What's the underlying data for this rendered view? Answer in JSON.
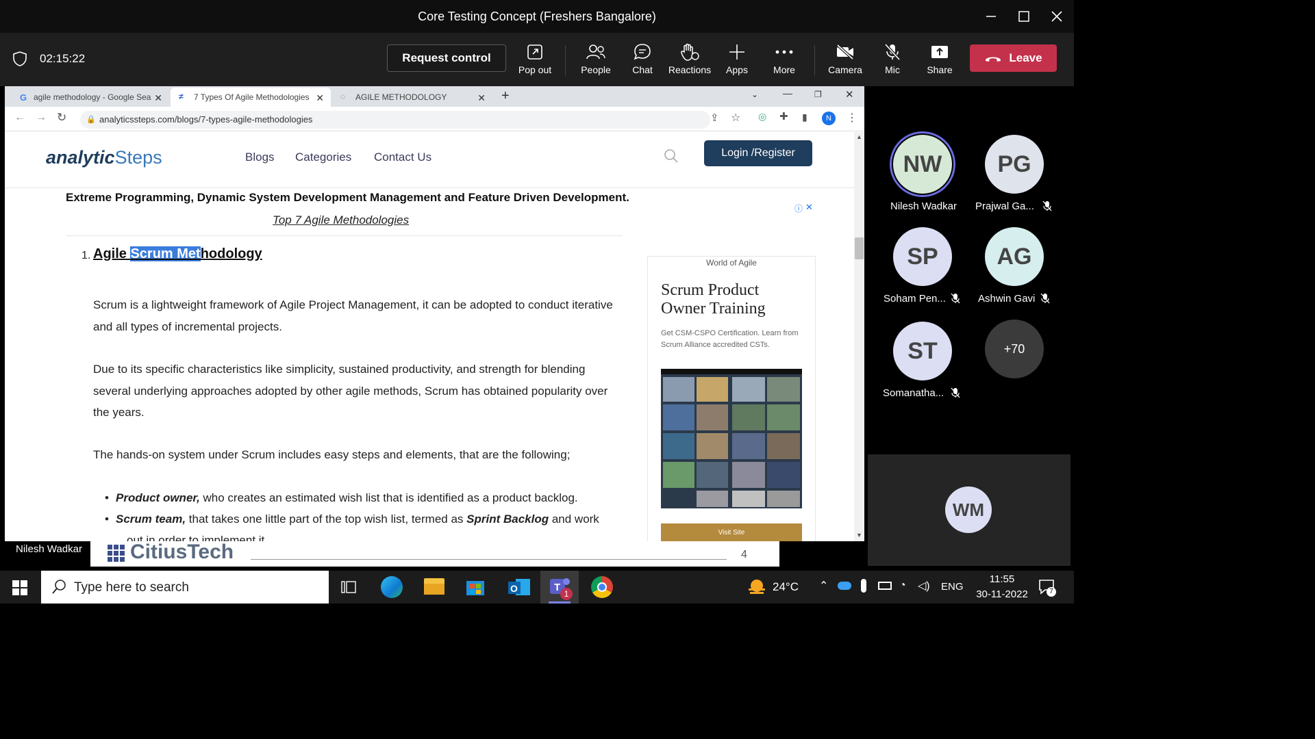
{
  "meeting": {
    "title": "Core Testing Concept (Freshers Bangalore)",
    "timer": "02:15:22",
    "request_control": "Request control",
    "toolbar": [
      {
        "label": "Pop out",
        "icon": "pop-out-icon"
      },
      {
        "label": "People",
        "icon": "people-icon"
      },
      {
        "label": "Chat",
        "icon": "chat-icon"
      },
      {
        "label": "Reactions",
        "icon": "reactions-icon"
      },
      {
        "label": "Apps",
        "icon": "apps-plus-icon"
      },
      {
        "label": "More",
        "icon": "more-dots-icon"
      },
      {
        "label": "Camera",
        "icon": "camera-off-icon"
      },
      {
        "label": "Mic",
        "icon": "mic-off-icon"
      },
      {
        "label": "Share",
        "icon": "share-icon"
      }
    ],
    "leave": "Leave",
    "presenter": "Nilesh Wadkar",
    "presenter_overlay": {
      "logo": "CitiusTech",
      "page": "4"
    }
  },
  "participants": [
    {
      "initials": "NW",
      "name": "Nilesh Wadkar",
      "muted": false,
      "color": "#d6e9d6",
      "speaking": true
    },
    {
      "initials": "PG",
      "name": "Prajwal Ga...",
      "muted": true,
      "color": "#dfe3ec"
    },
    {
      "initials": "SP",
      "name": "Soham Pen...",
      "muted": true,
      "color": "#dcdff3"
    },
    {
      "initials": "AG",
      "name": "Ashwin Gavi",
      "muted": true,
      "color": "#d7eeee"
    },
    {
      "initials": "ST",
      "name": "Somanatha...",
      "muted": true,
      "color": "#dcdff3"
    },
    {
      "initials": "+70",
      "name": "",
      "muted": false,
      "color": "#3b3b3b"
    },
    {
      "initials": "WM",
      "name": "",
      "muted": false,
      "color": "#dcdff3"
    }
  ],
  "browser": {
    "tabs": [
      {
        "label": "agile methodology - Google Sea",
        "active": false
      },
      {
        "label": "7 Types Of Agile Methodologies",
        "active": true
      },
      {
        "label": "AGILE METHODOLOGY",
        "active": false
      }
    ],
    "new_tab": "+",
    "url": "analyticssteps.com/blogs/7-types-agile-methodologies",
    "profile_initial": "N"
  },
  "site": {
    "logo_a": "analytic",
    "logo_b": "Steps",
    "nav": [
      "Blogs",
      "Categories",
      "Contact Us"
    ],
    "login": "Login /Register"
  },
  "article": {
    "lead": "Extreme Programming, Dynamic System Development Management and Feature Driven Development.",
    "caption": "Top 7 Agile Methodologies",
    "heading_num": "1.",
    "heading_a": "Agile ",
    "heading_sel": "Scrum Met",
    "heading_b": "hodology",
    "p1": "Scrum is a lightweight framework of Agile Project Management, it can be adopted to conduct iterative and all types of incremental projects.",
    "p2": "Due to its specific characteristics like simplicity, sustained productivity, and strength for blending several underlying approaches adopted by other agile methods, Scrum has obtained popularity over the years.",
    "p3": "The hands-on system under Scrum includes easy steps and elements, that are the following;",
    "b1_bold": "Product owner,",
    "b1_text": " who creates an estimated wish list that is identified as a product backlog.",
    "b2_bold": "Scrum team,",
    "b2_text": " that takes one little part of the top wish list, termed as ",
    "b2_bold2": "Sprint Backlog",
    "b2_text2": " and work",
    "b2_cut": "out in order to implement it."
  },
  "ad": {
    "brand": "World of Agile",
    "title": "Scrum Product Owner Training",
    "desc": "Get CSM-CSPO Certification. Learn from Scrum Alliance accredited CSTs.",
    "cta": "Visit Site"
  },
  "taskbar": {
    "search_placeholder": "Type here to search",
    "weather": "24°C",
    "lang": "ENG",
    "time": "11:55",
    "date": "30-11-2022",
    "notif_count": "7",
    "teams_badge": "1"
  }
}
